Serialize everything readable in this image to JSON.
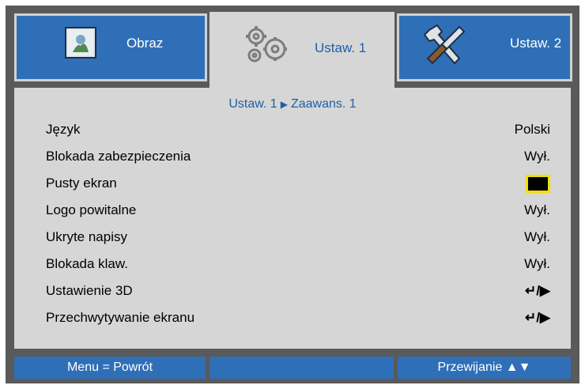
{
  "tabs": [
    {
      "label": "Obraz",
      "icon": "image-icon"
    },
    {
      "label": "Ustaw. 1",
      "icon": "gears-icon"
    },
    {
      "label": "Ustaw. 2",
      "icon": "tools-icon"
    }
  ],
  "breadcrumb": {
    "parent": "Ustaw. 1",
    "separator": "▶",
    "child": "Zaawans. 1"
  },
  "menu_items": [
    {
      "label": "Język",
      "value": "Polski"
    },
    {
      "label": "Blokada zabezpieczenia",
      "value": "Wył."
    },
    {
      "label": "Pusty ekran",
      "value": ""
    },
    {
      "label": "Logo powitalne",
      "value": "Wył."
    },
    {
      "label": "Ukryte napisy",
      "value": "Wył."
    },
    {
      "label": "Blokada klaw.",
      "value": "Wył."
    },
    {
      "label": "Ustawienie 3D",
      "value": "↵/▶"
    },
    {
      "label": "Przechwytywanie ekranu",
      "value": "↵/▶"
    }
  ],
  "footer": {
    "left": "Menu = Powrót",
    "middle": "",
    "right": "Przewijanie ▲▼"
  },
  "colors": {
    "accent_blue": "#2f6fb7",
    "panel_gray": "#d6d6d6",
    "highlight_yellow": "#f0e000"
  }
}
